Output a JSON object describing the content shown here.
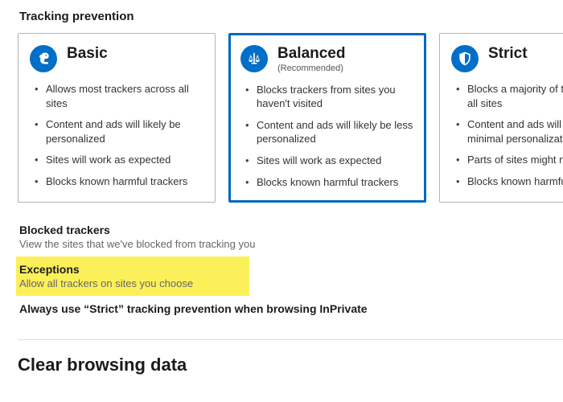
{
  "colors": {
    "accent": "#0067c0",
    "icon_bg": "#006fc7",
    "highlight": "#fcf05a"
  },
  "tracking": {
    "title": "Tracking prevention",
    "levels": [
      {
        "key": "basic",
        "title": "Basic",
        "sub": null,
        "icon": "squirrel-icon",
        "selected": false,
        "bullets": [
          "Allows most trackers across all sites",
          "Content and ads will likely be personalized",
          "Sites will work as expected",
          "Blocks known harmful trackers"
        ]
      },
      {
        "key": "balanced",
        "title": "Balanced",
        "sub": "(Recommended)",
        "icon": "scale-icon",
        "selected": true,
        "bullets": [
          "Blocks trackers from sites you haven't visited",
          "Content and ads will likely be less personalized",
          "Sites will work as expected",
          "Blocks known harmful trackers"
        ]
      },
      {
        "key": "strict",
        "title": "Strict",
        "sub": null,
        "icon": "shield-icon",
        "selected": false,
        "bullets": [
          "Blocks a majority of trackers from all sites",
          "Content and ads will likely have minimal personalization",
          "Parts of sites might not work",
          "Blocks known harmful trackers"
        ]
      }
    ],
    "links": {
      "blocked": {
        "title": "Blocked trackers",
        "desc": "View the sites that we've blocked from tracking you"
      },
      "exceptions": {
        "title": "Exceptions",
        "desc": "Allow all trackers on sites you choose"
      },
      "strict_inprivate": {
        "title": "Always use “Strict” tracking prevention when browsing InPrivate"
      }
    }
  },
  "clear": {
    "title": "Clear browsing data"
  }
}
